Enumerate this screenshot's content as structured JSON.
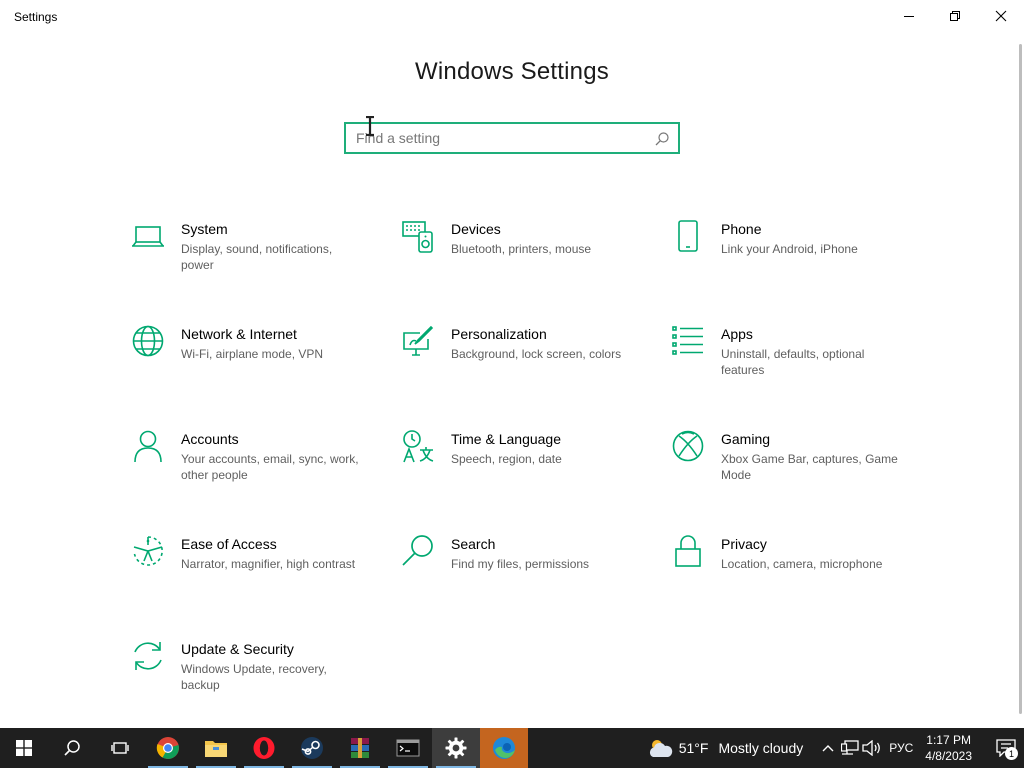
{
  "window": {
    "title": "Settings"
  },
  "header": {
    "title": "Windows Settings"
  },
  "search": {
    "placeholder": "Find a setting",
    "value": ""
  },
  "accent_color": "#00a870",
  "categories": [
    {
      "name": "System",
      "desc": "Display, sound, notifications, power",
      "icon": "laptop-icon"
    },
    {
      "name": "Devices",
      "desc": "Bluetooth, printers, mouse",
      "icon": "devices-icon"
    },
    {
      "name": "Phone",
      "desc": "Link your Android, iPhone",
      "icon": "phone-icon"
    },
    {
      "name": "Network & Internet",
      "desc": "Wi-Fi, airplane mode, VPN",
      "icon": "globe-icon"
    },
    {
      "name": "Personalization",
      "desc": "Background, lock screen, colors",
      "icon": "paint-icon"
    },
    {
      "name": "Apps",
      "desc": "Uninstall, defaults, optional features",
      "icon": "apps-list-icon"
    },
    {
      "name": "Accounts",
      "desc": "Your accounts, email, sync, work, other people",
      "icon": "person-icon"
    },
    {
      "name": "Time & Language",
      "desc": "Speech, region, date",
      "icon": "time-language-icon"
    },
    {
      "name": "Gaming",
      "desc": "Xbox Game Bar, captures, Game Mode",
      "icon": "xbox-icon"
    },
    {
      "name": "Ease of Access",
      "desc": "Narrator, magnifier, high contrast",
      "icon": "ease-of-access-icon"
    },
    {
      "name": "Search",
      "desc": "Find my files, permissions",
      "icon": "search-icon"
    },
    {
      "name": "Privacy",
      "desc": "Location, camera, microphone",
      "icon": "lock-icon"
    },
    {
      "name": "Update & Security",
      "desc": "Windows Update, recovery, backup",
      "icon": "update-icon"
    }
  ],
  "taskbar": {
    "apps": [
      "start-icon",
      "search-icon",
      "task-view-icon",
      "chrome-icon",
      "file-explorer-icon",
      "opera-icon",
      "steam-icon",
      "winrar-icon",
      "terminal-icon",
      "settings-gear-icon",
      "edge-icon"
    ],
    "weather": {
      "temp": "51°F",
      "condition": "Mostly cloudy"
    },
    "language": "РУС",
    "time": "1:17 PM",
    "date": "4/8/2023",
    "notification_count": "1"
  }
}
